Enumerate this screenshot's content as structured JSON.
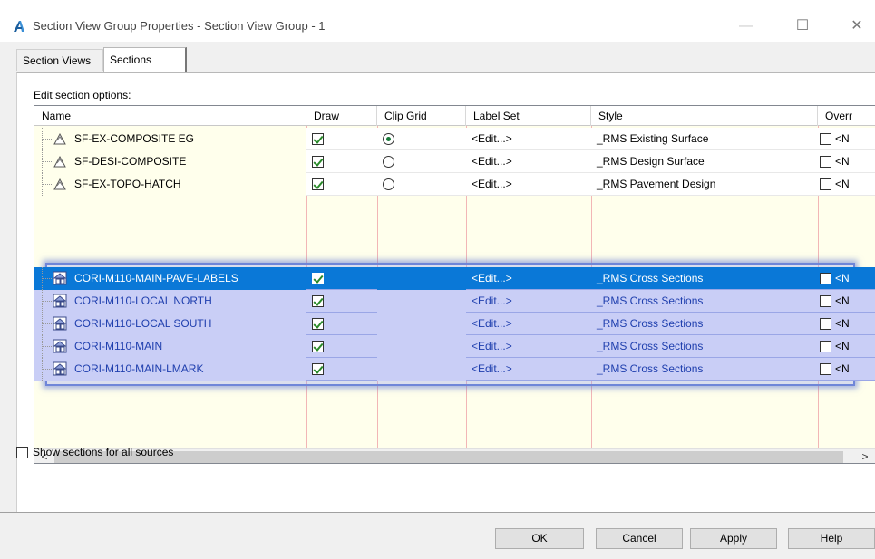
{
  "window": {
    "title": "Section View Group Properties - Section View Group - 1",
    "minimize": "—",
    "maximize": "☐",
    "close": "✕"
  },
  "tabs": [
    {
      "label": "Section Views",
      "active": false
    },
    {
      "label": "Sections",
      "active": true
    }
  ],
  "edit_label": "Edit section options:",
  "columns": {
    "name": "Name",
    "draw": "Draw",
    "clip": "Clip Grid",
    "label": "Label Set",
    "style": "Style",
    "override": "Overr"
  },
  "rows": [
    {
      "name": "SF-EX-COMPOSITE EG",
      "icon": "surface-icon",
      "draw": true,
      "clip": "selected",
      "label": "<Edit...>",
      "style": "_RMS Existing Surface",
      "override": "<N"
    },
    {
      "name": "SF-DESI-COMPOSITE",
      "icon": "surface-icon",
      "draw": true,
      "clip": "unselected",
      "label": "<Edit...>",
      "style": "_RMS Design Surface",
      "override": "<N"
    },
    {
      "name": "SF-EX-TOPO-HATCH",
      "icon": "surface-icon",
      "draw": true,
      "clip": "unselected",
      "label": "<Edit...>",
      "style": "_RMS Pavement Design",
      "override": "<N"
    },
    {
      "name": "CORI-M110-MAIN-PAVE-LABELS",
      "icon": "corridor-icon",
      "draw": true,
      "clip": "none",
      "label": "<Edit...>",
      "style": "_RMS Cross Sections",
      "override": "<N"
    },
    {
      "name": "CORI-M110-LOCAL NORTH",
      "icon": "corridor-icon",
      "draw": true,
      "clip": "none",
      "label": "<Edit...>",
      "style": "_RMS Cross Sections",
      "override": "<N"
    },
    {
      "name": "CORI-M110-LOCAL SOUTH",
      "icon": "corridor-icon",
      "draw": true,
      "clip": "none",
      "label": "<Edit...>",
      "style": "_RMS Cross Sections",
      "override": "<N"
    },
    {
      "name": "CORI-M110-MAIN",
      "icon": "corridor-icon",
      "draw": true,
      "clip": "none",
      "label": "<Edit...>",
      "style": "_RMS Cross Sections",
      "override": "<N"
    },
    {
      "name": "CORI-M110-MAIN-LMARK",
      "icon": "corridor-icon",
      "draw": true,
      "clip": "none",
      "label": "<Edit...>",
      "style": "_RMS Cross Sections",
      "override": "<N"
    }
  ],
  "scroll": {
    "left": "<",
    "right": ">"
  },
  "show_all": {
    "label": "Show sections for all sources",
    "checked": false
  },
  "buttons": {
    "ok": "OK",
    "cancel": "Cancel",
    "apply": "Apply",
    "help": "Help"
  },
  "colors": {
    "selection": "#0a78d7",
    "highlight_border": "#6f86d8",
    "grid_bg": "#ffffec",
    "grid_line": "#f2b6b6"
  }
}
